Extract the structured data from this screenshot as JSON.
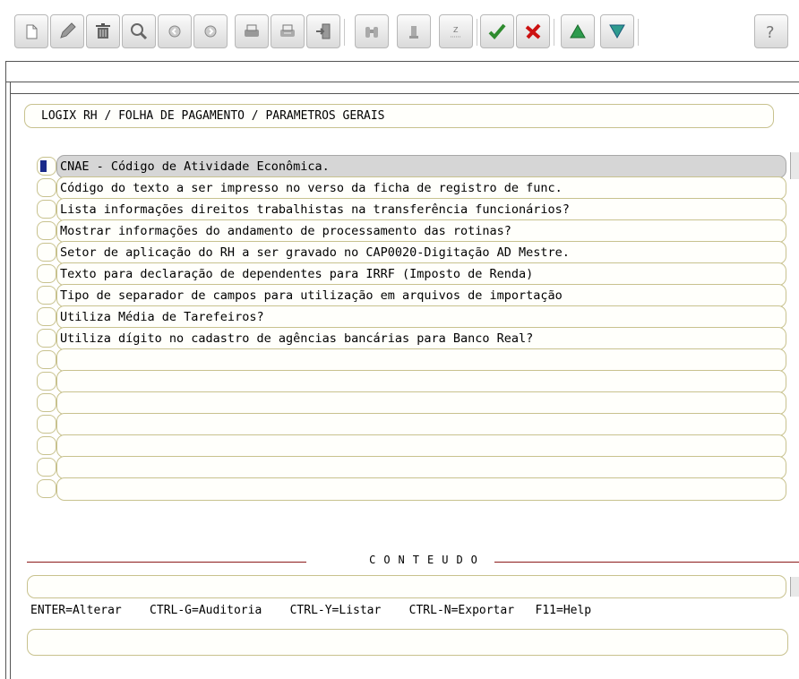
{
  "toolbar": {
    "buttons": [
      {
        "name": "new",
        "icon": "new-doc-icon"
      },
      {
        "name": "edit",
        "icon": "pencil-icon"
      },
      {
        "name": "delete",
        "icon": "trash-icon"
      },
      {
        "name": "search",
        "icon": "magnifier-icon"
      },
      {
        "name": "previous",
        "icon": "arrow-left-icon"
      },
      {
        "name": "next",
        "icon": "arrow-right-icon"
      },
      {
        "name": "print",
        "icon": "printer-icon"
      },
      {
        "name": "print-setup",
        "icon": "printer-setup-icon"
      },
      {
        "name": "exit",
        "icon": "exit-door-icon"
      },
      {
        "name": "binoculars",
        "icon": "binoculars-icon"
      },
      {
        "name": "details",
        "icon": "details-icon"
      },
      {
        "name": "zoom",
        "icon": "zoom-list-icon"
      },
      {
        "name": "confirm",
        "icon": "checkmark-icon"
      },
      {
        "name": "cancel",
        "icon": "red-x-icon"
      },
      {
        "name": "page-up",
        "icon": "triangle-up-icon"
      },
      {
        "name": "page-down",
        "icon": "triangle-down-icon"
      },
      {
        "name": "help",
        "icon": "question-mark-icon"
      }
    ]
  },
  "breadcrumb": "LOGIX RH / FOLHA DE PAGAMENTO / PARAMETROS GERAIS",
  "list": {
    "rows": [
      "CNAE - Código de Atividade Econômica.",
      "Código do texto a ser impresso no verso da ficha de registro de func.",
      "Lista informações direitos trabalhistas na transferência funcionários?",
      "Mostrar informações do andamento de processamento das rotinas?",
      "Setor de aplicação do RH a ser gravado no CAP0020-Digitação AD Mestre.",
      "Texto para declaração de dependentes para IRRF (Imposto de Renda)",
      "Tipo de separador de campos para utilização em arquivos de importação",
      "Utiliza Média de Tarefeiros?",
      "Utiliza dígito no cadastro de agências bancárias para Banco Real?",
      "",
      "",
      "",
      "",
      "",
      "",
      ""
    ],
    "selected_index": 0
  },
  "section_title": "CONTEUDO",
  "content_value": "",
  "hints": "ENTER=Alterar    CTRL-G=Auditoria    CTRL-Y=Listar    CTRL-N=Exportar   F11=Help",
  "status_value": "",
  "colors": {
    "field_border": "#c8c28e",
    "selection_marker": "#1a2a8a",
    "section_rule": "#8b1a1a",
    "confirm_green": "#2e8b2e",
    "cancel_red": "#cc1111"
  }
}
